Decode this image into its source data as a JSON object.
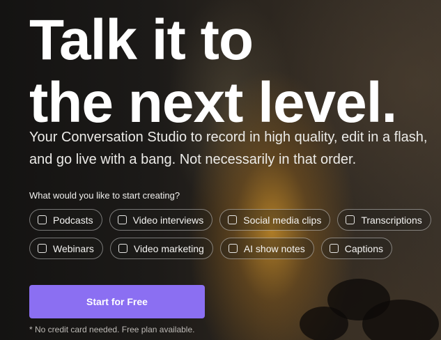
{
  "hero": {
    "headline_line1": "Talk it to",
    "headline_line2": "the next level.",
    "subhead_line1": "Your Conversation Studio to record in high quality, edit in a flash,",
    "subhead_line2": "and go live with a bang. Not necessarily in that order."
  },
  "creation_picker": {
    "question": "What would you like to start creating?",
    "row1": [
      {
        "label": "Podcasts",
        "checked": false
      },
      {
        "label": "Video interviews",
        "checked": false
      },
      {
        "label": "Social media clips",
        "checked": false
      },
      {
        "label": "Transcriptions",
        "checked": false
      }
    ],
    "row2": [
      {
        "label": "Webinars",
        "checked": false
      },
      {
        "label": "Video marketing",
        "checked": false
      },
      {
        "label": "AI show notes",
        "checked": false
      },
      {
        "label": "Captions",
        "checked": false
      }
    ]
  },
  "cta": {
    "label": "Start for Free",
    "color": "#8b6ff2"
  },
  "footnote": "* No credit card needed. Free plan available."
}
